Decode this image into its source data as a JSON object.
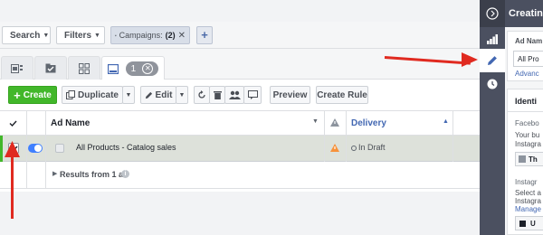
{
  "topbar": {
    "search_label": "Search",
    "filters_label": "Filters",
    "campaign_chip_label": "Campaigns:",
    "campaign_chip_count": "(2)",
    "add_label": "+"
  },
  "tabs": {
    "badge_count": "1"
  },
  "toolbar": {
    "create_label": "Create",
    "duplicate_label": "Duplicate",
    "edit_label": "Edit",
    "preview_label": "Preview",
    "create_rule_label": "Create Rule"
  },
  "table": {
    "col_ad_name": "Ad Name",
    "col_delivery": "Delivery",
    "rows": [
      {
        "name": "All Products - Catalog sales",
        "delivery": "In Draft"
      }
    ],
    "results_label": "Results from 1 ad"
  },
  "panel": {
    "header_title": "Creating",
    "ad_name_label": "Ad Nam",
    "ad_name_value": "All Pro",
    "advanced_link": "Advanc",
    "identity_label": "Identi",
    "facebook_label": "Facebo",
    "your_bus_text": "Your bu",
    "instagra_text": "Instagra",
    "fb_page_button": "Th",
    "instagram_label": "Instagr",
    "select_text": "Select a",
    "instagra_text2": "Instagra",
    "manage_link": "Manage",
    "use_button": "U"
  },
  "colors": {
    "accent_green": "#42b72a",
    "toggle_blue": "#4080ff",
    "arrow_red": "#e02a20",
    "nav_dark": "#4b5060"
  }
}
